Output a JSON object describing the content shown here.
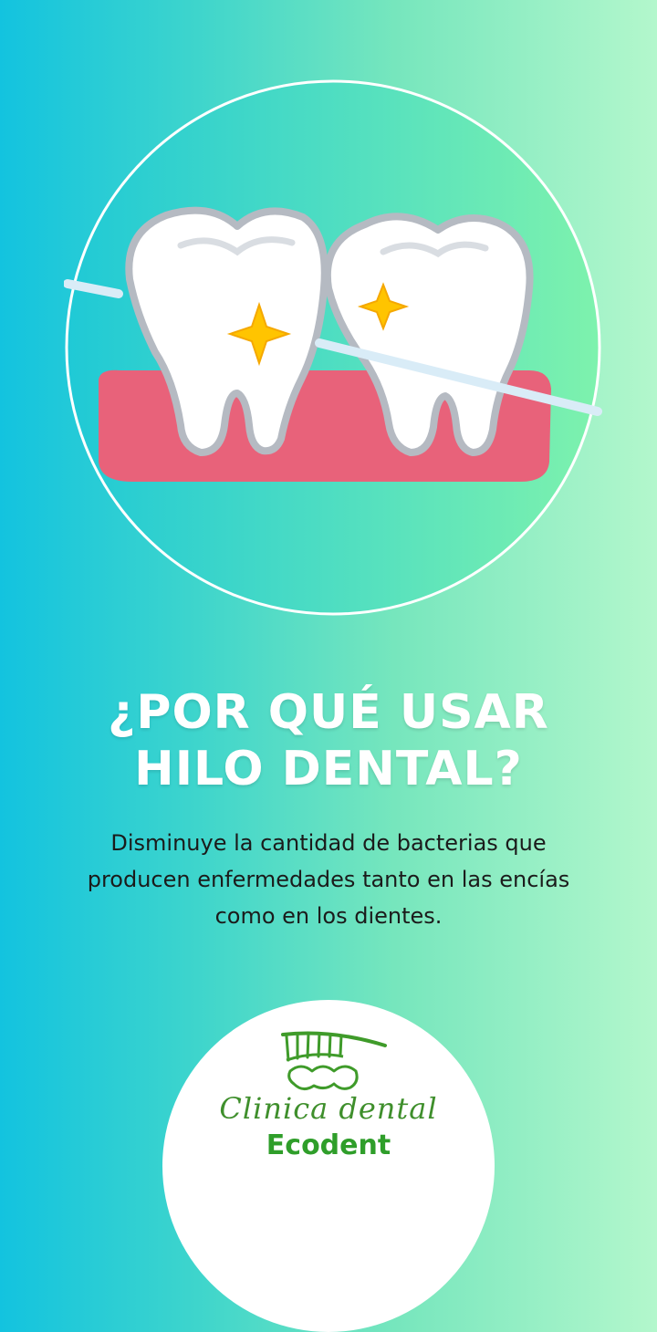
{
  "hero": {
    "illustration": "tooth-floss-icon"
  },
  "headline": {
    "line1": "¿POR QUÉ USAR",
    "line2": "HILO DENTAL?"
  },
  "body": {
    "line1": "Disminuye la cantidad de bacterias que",
    "line2": "producen enfermedades tanto en las encías",
    "line3": "como en los dientes."
  },
  "logo": {
    "icon": "toothbrush-teeth-icon",
    "script": "Clinica dental",
    "brand": "Ecodent"
  },
  "colors": {
    "gradient_start": "#13c3df",
    "gradient_end": "#b3f7cc",
    "gum": "#e8627a",
    "sparkle": "#ffc400",
    "brand_green": "#2f9e2a"
  }
}
